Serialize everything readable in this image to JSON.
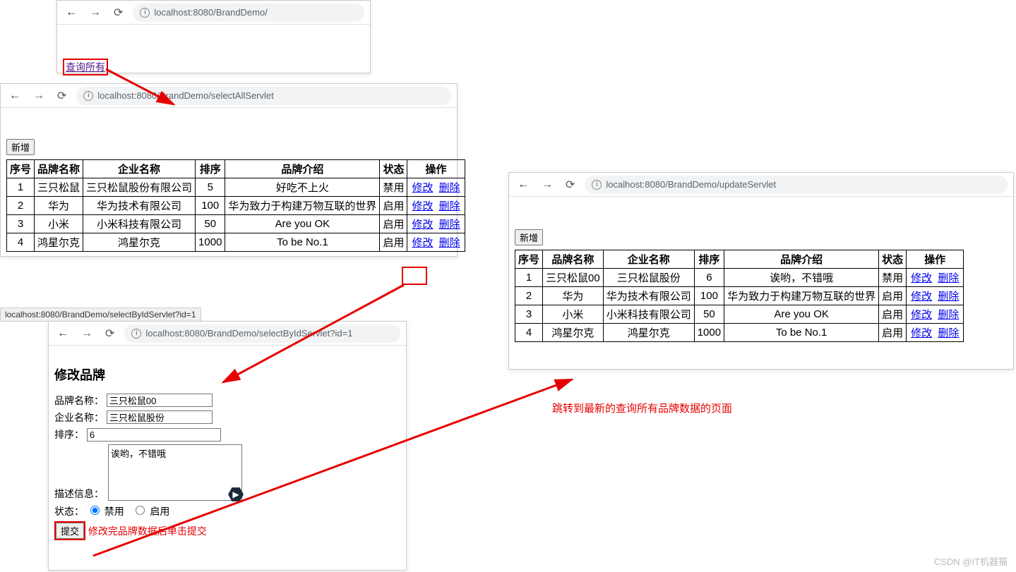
{
  "watermark": "CSDN @IT机器猫",
  "urls": {
    "w1": "localhost:8080/BrandDemo/",
    "w2": "localhost:8080/BrandDemo/selectAllServlet",
    "w3": "localhost:8080/BrandDemo/selectByIdServlet?id=1",
    "w4": "localhost:8080/BrandDemo/updateServlet",
    "status": "localhost:8080/BrandDemo/selectByIdServlet?id=1"
  },
  "w1": {
    "link": "查询所有"
  },
  "buttons": {
    "add": "新增",
    "submit": "提交"
  },
  "headers": {
    "id": "序号",
    "name": "品牌名称",
    "company": "企业名称",
    "order": "排序",
    "desc": "品牌介绍",
    "status": "状态",
    "op": "操作"
  },
  "ops": {
    "edit": "修改",
    "del": "删除"
  },
  "status": {
    "on": "启用",
    "off": "禁用"
  },
  "tableA": [
    {
      "id": "1",
      "name": "三只松鼠",
      "company": "三只松鼠股份有限公司",
      "order": "5",
      "desc": "好吃不上火",
      "status": "禁用"
    },
    {
      "id": "2",
      "name": "华为",
      "company": "华为技术有限公司",
      "order": "100",
      "desc": "华为致力于构建万物互联的世界",
      "status": "启用"
    },
    {
      "id": "3",
      "name": "小米",
      "company": "小米科技有限公司",
      "order": "50",
      "desc": "Are you OK",
      "status": "启用"
    },
    {
      "id": "4",
      "name": "鸿星尔克",
      "company": "鸿星尔克",
      "order": "1000",
      "desc": "To be No.1",
      "status": "启用"
    }
  ],
  "tableB": [
    {
      "id": "1",
      "name": "三只松鼠00",
      "company": "三只松鼠股份",
      "order": "6",
      "desc": "诶哟，不错哦",
      "status": "禁用"
    },
    {
      "id": "2",
      "name": "华为",
      "company": "华为技术有限公司",
      "order": "100",
      "desc": "华为致力于构建万物互联的世界",
      "status": "启用"
    },
    {
      "id": "3",
      "name": "小米",
      "company": "小米科技有限公司",
      "order": "50",
      "desc": "Are you OK",
      "status": "启用"
    },
    {
      "id": "4",
      "name": "鸿星尔克",
      "company": "鸿星尔克",
      "order": "1000",
      "desc": "To be No.1",
      "status": "启用"
    }
  ],
  "form": {
    "title": "修改品牌",
    "labels": {
      "name": "品牌名称：",
      "company": "企业名称：",
      "order": "排序：",
      "desc": "描述信息：",
      "status": "状态："
    },
    "values": {
      "name": "三只松鼠00",
      "company": "三只松鼠股份",
      "order": "6",
      "desc": "诶哟，不错哦"
    },
    "radios": {
      "off": "禁用",
      "on": "启用"
    }
  },
  "annotations": {
    "submit": "修改完品牌数据后单击提交",
    "jump": "跳转到最新的查询所有品牌数据的页面"
  }
}
